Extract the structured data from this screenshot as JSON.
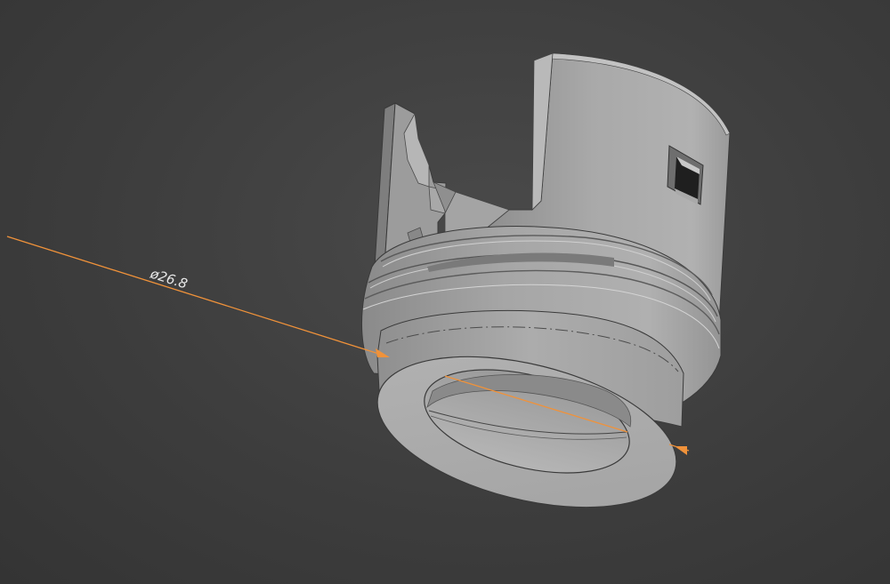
{
  "viewport": {
    "background": "#3d3d3d",
    "model_color": "#a6a6a6",
    "dimension_color": "#f0923a"
  },
  "dimension": {
    "label": "ø26.8",
    "kind": "diameter"
  }
}
